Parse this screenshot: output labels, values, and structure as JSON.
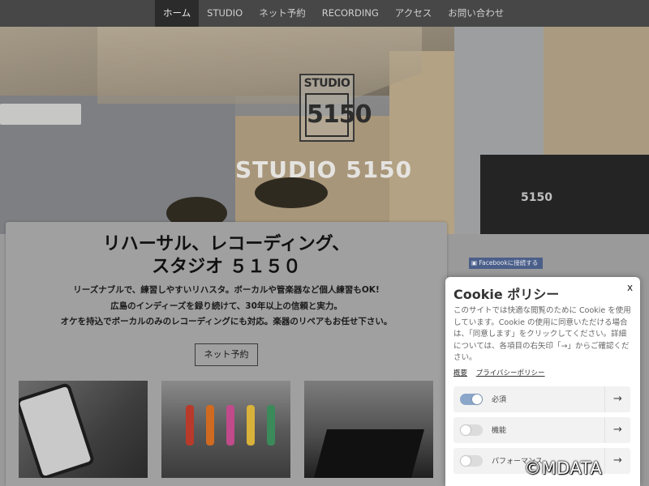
{
  "nav": {
    "items": [
      "ホーム",
      "STUDIO",
      "ネット予約",
      "RECORDING",
      "アクセス",
      "お問い合わせ"
    ],
    "active": "ホーム"
  },
  "hero": {
    "logo_top": "STUDIO",
    "logo_number": "5150",
    "title": "STUDIO 5150",
    "amp_label": "5150"
  },
  "main": {
    "headline_line1": "リハーサル、レコーディング、",
    "headline_line2": "スタジオ ５１５０",
    "lead_lines": [
      "リーズナブルで、練習しやすいリハスタ。ボーカルや管楽器など個人練習もOK!",
      "広島のインディーズを録り続けて、30年以上の信頼と実力。",
      "オケを持込でボーカルのみのレコーディングにも対応。楽器のリペアもお任せ下さい。"
    ],
    "reserve_button": "ネット予約"
  },
  "facebook_badge": "Facebookに接続する",
  "cookie": {
    "title": "Cookie ポリシー",
    "close": "x",
    "body": "このサイトでは快適な閲覧のために Cookie を使用しています。Cookie の使用に同意いただける場合は、「同意します」をクリックしてください。詳細については、各項目の右矢印「→」からご確認ください。",
    "link_summary": "概要",
    "link_privacy": "プライバシーポリシー",
    "rows": [
      {
        "label": "必須",
        "enabled": true
      },
      {
        "label": "機能",
        "enabled": false
      },
      {
        "label": "パフォーマンス",
        "enabled": false
      }
    ],
    "arrow": "→"
  },
  "watermark": "©MDATA",
  "colors": {
    "nav_bg": "#474747",
    "nav_active_bg": "#2b2b2b",
    "toggle_on": "#8aa6c8",
    "facebook": "#4b5f8a"
  }
}
